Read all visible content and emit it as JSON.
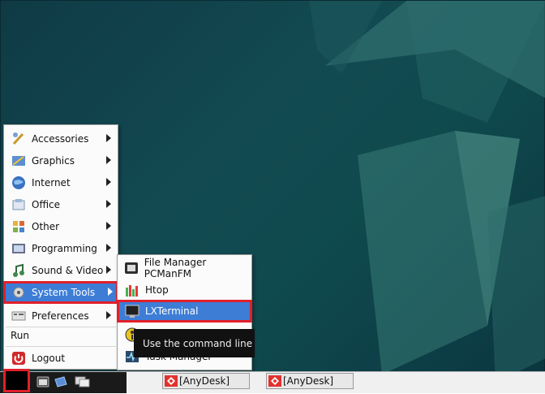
{
  "main_menu": {
    "items": [
      {
        "label": "Accessories",
        "icon": "accessories-icon",
        "submenu": true
      },
      {
        "label": "Graphics",
        "icon": "graphics-icon",
        "submenu": true
      },
      {
        "label": "Internet",
        "icon": "internet-icon",
        "submenu": true
      },
      {
        "label": "Office",
        "icon": "office-icon",
        "submenu": true
      },
      {
        "label": "Other",
        "icon": "other-icon",
        "submenu": true
      },
      {
        "label": "Programming",
        "icon": "programming-icon",
        "submenu": true
      },
      {
        "label": "Sound & Video",
        "icon": "sound-video-icon",
        "submenu": true
      },
      {
        "label": "System Tools",
        "icon": "system-tools-icon",
        "submenu": true,
        "active": true
      },
      {
        "label": "Preferences",
        "icon": "preferences-icon",
        "submenu": true
      }
    ],
    "run_label": "Run",
    "logout_label": "Logout"
  },
  "system_tools_submenu": {
    "items": [
      {
        "label": "File Manager PCManFM",
        "icon": "file-manager-icon"
      },
      {
        "label": "Htop",
        "icon": "htop-icon"
      },
      {
        "label": "LXTerminal",
        "icon": "terminal-icon",
        "active": true
      },
      {
        "label": "",
        "icon": "unknown-tool-icon"
      },
      {
        "label": "Task Manager",
        "icon": "task-manager-icon"
      }
    ]
  },
  "tooltip": {
    "text": "Use the command line"
  },
  "taskbar": {
    "tasks": [
      {
        "label": "[AnyDesk]"
      },
      {
        "label": "[AnyDesk]"
      }
    ]
  },
  "colors": {
    "desktop_bg": "#134a52",
    "menu_highlight": "#3d7dd6",
    "annotation_red": "#e0202a"
  }
}
